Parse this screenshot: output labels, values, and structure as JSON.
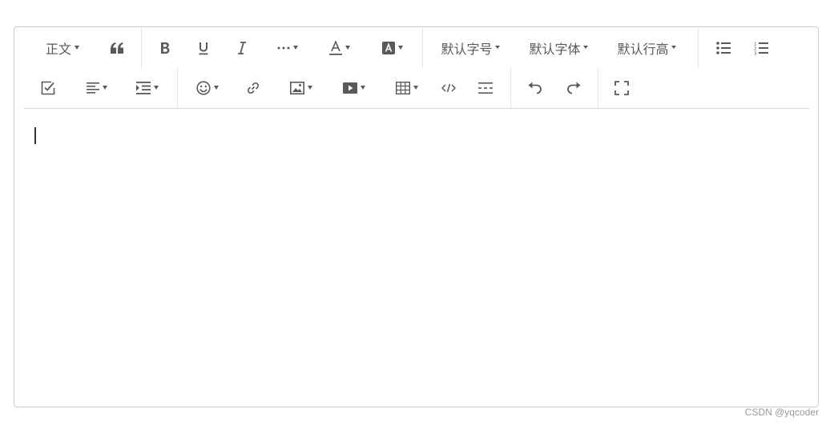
{
  "toolbar": {
    "heading_label": "正文",
    "font_size_label": "默认字号",
    "font_family_label": "默认字体",
    "line_height_label": "默认行高",
    "icons": {
      "quote": "quote-icon",
      "bold": "bold-icon",
      "underline": "underline-icon",
      "italic": "italic-icon",
      "more": "more-icon",
      "font_color": "font-color-icon",
      "bg_color": "background-color-icon",
      "bulleted_list": "bulleted-list-icon",
      "numbered_list": "numbered-list-icon",
      "todo": "todo-icon",
      "align": "align-icon",
      "indent": "indent-icon",
      "emotion": "emotion-icon",
      "link": "link-icon",
      "image": "image-icon",
      "video": "video-icon",
      "table": "table-icon",
      "code": "code-icon",
      "divider": "divider-icon",
      "undo": "undo-icon",
      "redo": "redo-icon",
      "fullscreen": "fullscreen-icon"
    }
  },
  "editor": {
    "text": ""
  },
  "watermark": "CSDN @yqcoder"
}
